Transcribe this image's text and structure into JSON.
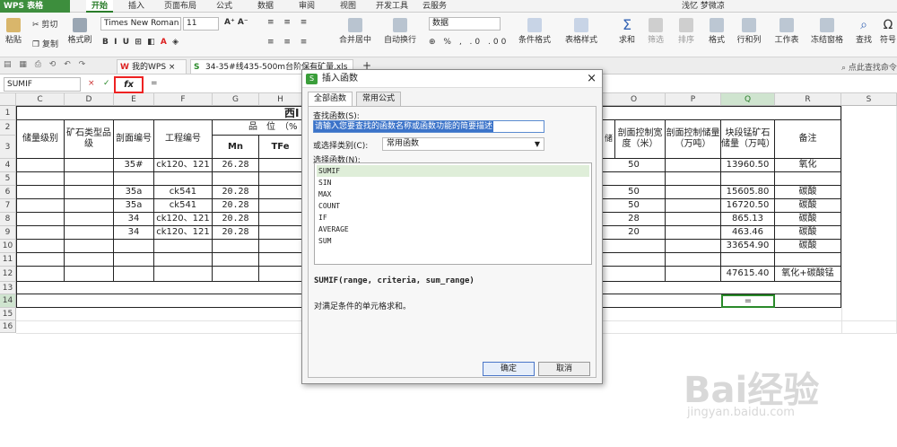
{
  "menubar": {
    "app": "WPS 表格",
    "tabs": [
      "开始",
      "插入",
      "页面布局",
      "公式",
      "数据",
      "审阅",
      "视图",
      "开发工具",
      "云服务"
    ],
    "user": "浅忆 梦微凉"
  },
  "ribbon": {
    "paste": "粘贴",
    "cut": "剪切",
    "copy": "复制",
    "format_painter": "格式刷",
    "font_name": "Times New Roman",
    "font_size": "11",
    "merge": "合并居中",
    "wrap": "自动换行",
    "number_format": "数据",
    "cond_format": "条件格式",
    "table_style": "表格样式",
    "sum": "求和",
    "filter": "筛选",
    "sort": "排序",
    "format": "格式",
    "rowcol": "行和列",
    "sheet": "工作表",
    "freeze": "冻结窗格",
    "find": "查找",
    "symbol": "符号"
  },
  "docbar": {
    "tabs": [
      "我的WPS",
      "34-35#线435-500m台阶保有矿量.xls"
    ],
    "add": "+",
    "help_search": "点此查找命令"
  },
  "formulabar": {
    "namebox": "SUMIF",
    "cancel": "×",
    "confirm": "✓",
    "fx": "fx",
    "content": "="
  },
  "sheet": {
    "columns": [
      "C",
      "D",
      "E",
      "F",
      "G",
      "H",
      "O",
      "P",
      "Q",
      "R",
      "S"
    ],
    "rows": [
      "1",
      "2",
      "3",
      "4",
      "5",
      "6",
      "7",
      "8",
      "9",
      "10",
      "11",
      "12",
      "13",
      "14",
      "15",
      "16"
    ],
    "title_fragment": "西I",
    "header_pinwei": "品　位　（%",
    "h_storage": "储量级别",
    "h_oretype": "矿石类型品级",
    "h_section": "剖面编号",
    "h_project": "工程编号",
    "h_mn": "Mn",
    "h_tfe": "TFe",
    "h_width_fragment": "储",
    "h_width": "剖面控制宽度（米）",
    "h_reserve": "剖面控制储量（万吨）",
    "h_block": "块段锰矿石储量（万吨）",
    "h_note": "备注",
    "data_rows": [
      {
        "e": "35#",
        "f": "ck120、121",
        "g": "26.28",
        "o": "50",
        "q": "13960.50",
        "r": "氧化"
      },
      {
        "e": "",
        "f": "",
        "g": "",
        "o": "",
        "q": "",
        "r": ""
      },
      {
        "e": "35a",
        "f": "ck541",
        "g": "20.28",
        "o": "50",
        "q": "15605.80",
        "r": "碳酸"
      },
      {
        "e": "35a",
        "f": "ck541",
        "g": "20.28",
        "o": "50",
        "q": "16720.50",
        "r": "碳酸"
      },
      {
        "e": "34",
        "f": "ck120、121",
        "g": "20.28",
        "o": "28",
        "q": "865.13",
        "r": "碳酸"
      },
      {
        "e": "34",
        "f": "ck120、121",
        "g": "20.28",
        "o": "20",
        "q": "463.46",
        "r": "碳酸"
      },
      {
        "e": "",
        "f": "",
        "g": "",
        "o": "",
        "q": "33654.90",
        "r": "碳酸"
      },
      {
        "e": "",
        "f": "",
        "g": "",
        "o": "",
        "q": "",
        "r": ""
      },
      {
        "e": "",
        "f": "",
        "g": "",
        "o": "",
        "q": "47615.40",
        "r": "氧化+碳酸锰"
      }
    ],
    "active_cell": "="
  },
  "dialog": {
    "title": "插入函数",
    "close": "×",
    "tabs": [
      "全部函数",
      "常用公式"
    ],
    "search_label": "查找函数(S):",
    "search_value": "请输入您要查找的函数名称或函数功能的简要描述",
    "category_label": "或选择类别(C):",
    "category_value": "常用函数",
    "select_label": "选择函数(N):",
    "functions": [
      "SUMIF",
      "SIN",
      "MAX",
      "COUNT",
      "IF",
      "AVERAGE",
      "SUM"
    ],
    "signature": "SUMIF(range, criteria, sum_range)",
    "description": "对满足条件的单元格求和。",
    "ok": "确定",
    "cancel": "取消"
  },
  "watermark": {
    "brand": "Bai经验",
    "url": "jingyan.baidu.com"
  }
}
